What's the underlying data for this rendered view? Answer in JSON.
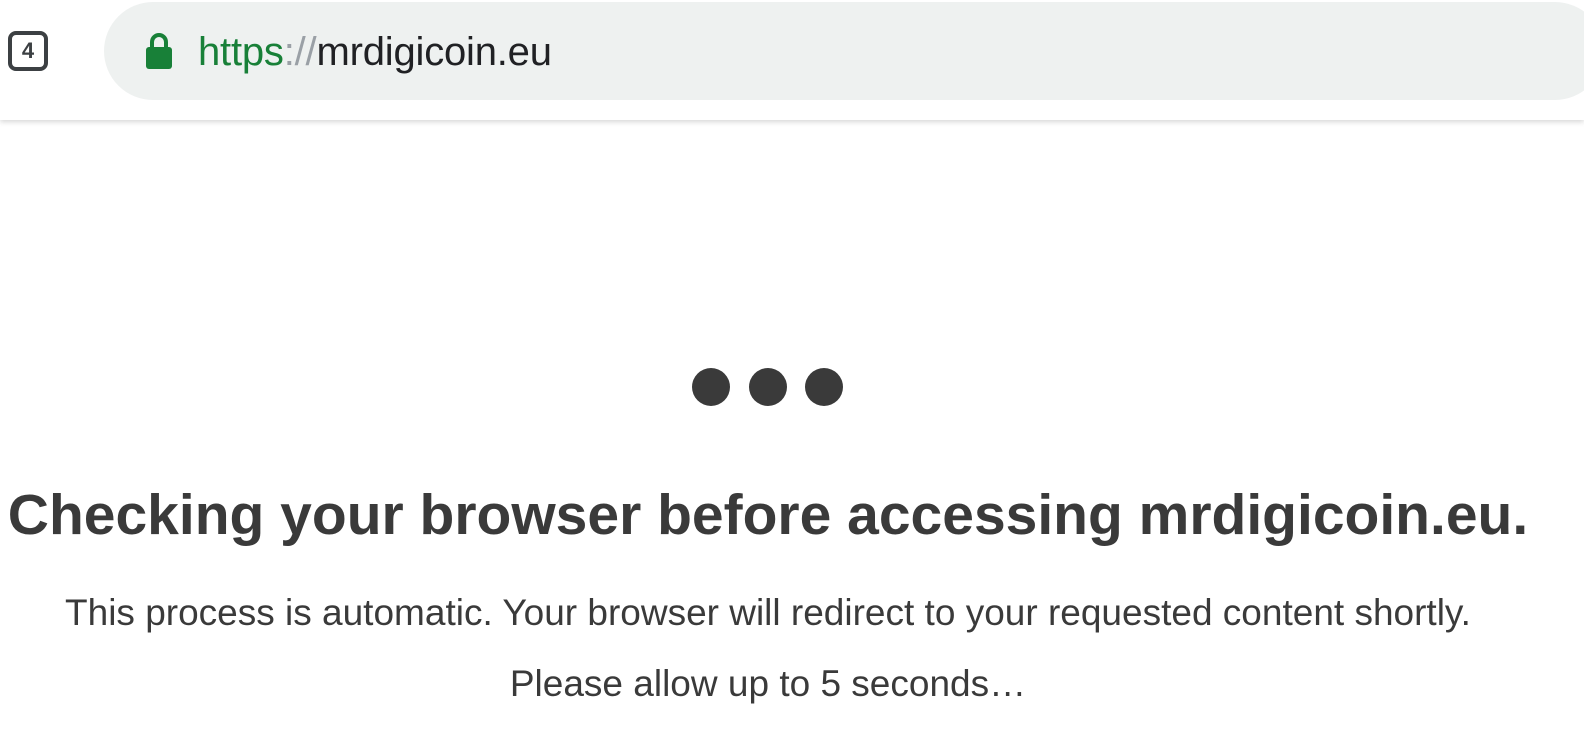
{
  "browser": {
    "tab_count": "4",
    "url": {
      "scheme": "https",
      "separator": "://",
      "host": "mrdigicoin.eu"
    }
  },
  "page": {
    "heading": "Checking your browser before accessing mrdigicoin.eu.",
    "message_line1": "This process is automatic. Your browser will redirect to your requested content shortly.",
    "message_line2": "Please allow up to 5 seconds…"
  },
  "colors": {
    "secure_green": "#188038",
    "text_dark": "#3a3a3a",
    "omnibox_bg": "#eef1f0"
  },
  "icons": {
    "lock": "lock-icon",
    "loading": "loading-dots-icon"
  }
}
